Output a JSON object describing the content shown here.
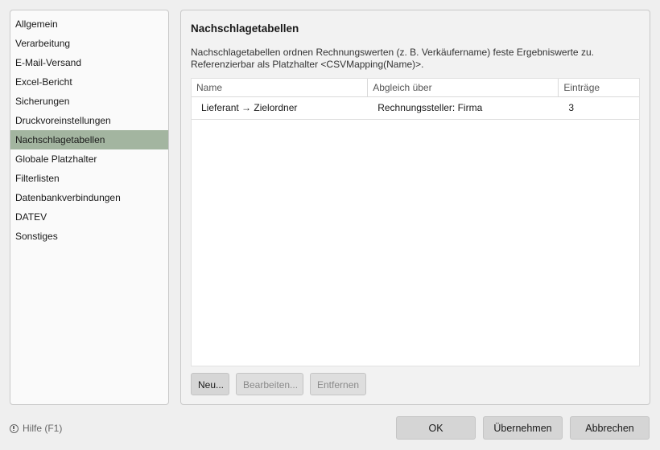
{
  "sidebar": {
    "items": [
      {
        "label": "Allgemein"
      },
      {
        "label": "Verarbeitung"
      },
      {
        "label": "E-Mail-Versand"
      },
      {
        "label": "Excel-Bericht"
      },
      {
        "label": "Sicherungen"
      },
      {
        "label": "Druckvoreinstellungen"
      },
      {
        "label": "Nachschlagetabellen",
        "active": true
      },
      {
        "label": "Globale Platzhalter"
      },
      {
        "label": "Filterlisten"
      },
      {
        "label": "Datenbankverbindungen"
      },
      {
        "label": "DATEV"
      },
      {
        "label": "Sonstiges"
      }
    ]
  },
  "panel": {
    "title": "Nachschlagetabellen",
    "description_line1": "Nachschlagetabellen ordnen Rechnungswerten (z. B. Verkäufername) feste Ergebniswerte zu.",
    "description_line2": "Referenzierbar als Platzhalter <CSVMapping(Name)>."
  },
  "table": {
    "columns": [
      "Name",
      "Abgleich über",
      "Einträge"
    ],
    "rows": [
      [
        "Lieferant → Zielordner",
        "Rechnungssteller: Firma",
        "3"
      ]
    ]
  },
  "buttons": {
    "new": "Neu...",
    "edit": "Bearbeiten...",
    "remove": "Entfernen"
  },
  "footer": {
    "help": "Hilfe (F1)",
    "ok": "OK",
    "apply": "Übernehmen",
    "cancel": "Abbrechen"
  },
  "colors": {
    "sidebar_active": "#a3b5a0"
  }
}
